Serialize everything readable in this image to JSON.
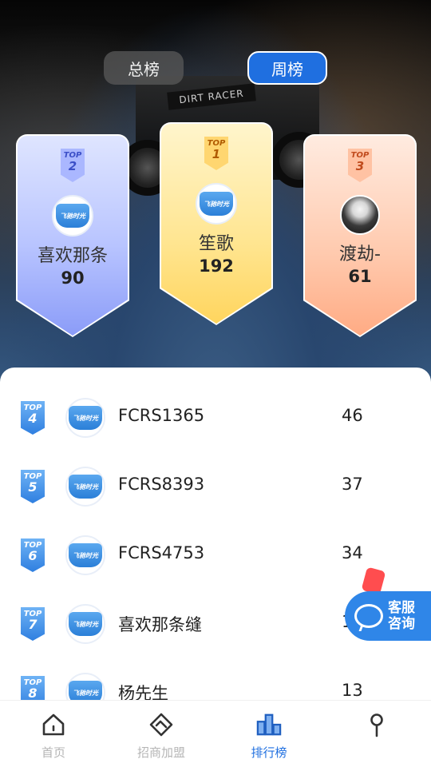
{
  "toggle": {
    "total_label": "总榜",
    "weekly_label": "周榜",
    "active": "weekly"
  },
  "hero": {
    "background_text": "DIRT RACER"
  },
  "podium": [
    {
      "rank_label": "TOP",
      "rank": "2",
      "name": "喜欢那条",
      "score": "90",
      "avatar": "brand-logo"
    },
    {
      "rank_label": "TOP",
      "rank": "1",
      "name": "笙歌",
      "score": "192",
      "avatar": "brand-logo"
    },
    {
      "rank_label": "TOP",
      "rank": "3",
      "name": "渡劫-",
      "score": "61",
      "avatar": "user-photo"
    }
  ],
  "logo_text": "飞驰时光",
  "list": [
    {
      "rank_label": "TOP",
      "rank": "4",
      "name": "FCRS1365",
      "score": "46"
    },
    {
      "rank_label": "TOP",
      "rank": "5",
      "name": "FCRS8393",
      "score": "37"
    },
    {
      "rank_label": "TOP",
      "rank": "6",
      "name": "FCRS4753",
      "score": "34"
    },
    {
      "rank_label": "TOP",
      "rank": "7",
      "name": "喜欢那条缝",
      "score": "1"
    },
    {
      "rank_label": "TOP",
      "rank": "8",
      "name": "杨先生",
      "score": "13"
    }
  ],
  "customer_service": {
    "label": "客服咨询"
  },
  "tabbar": [
    {
      "label": "首页",
      "icon": "home-icon",
      "active": false
    },
    {
      "label": "招商加盟",
      "icon": "handshake-icon",
      "active": false
    },
    {
      "label": "排行榜",
      "icon": "ranking-icon",
      "active": true
    },
    {
      "label": "",
      "icon": "profile-icon",
      "active": false
    }
  ],
  "colors": {
    "accent": "#1f6fe0",
    "gold": "#ffd55e",
    "silver": "#8b9cf8",
    "bronze": "#ffab84"
  }
}
